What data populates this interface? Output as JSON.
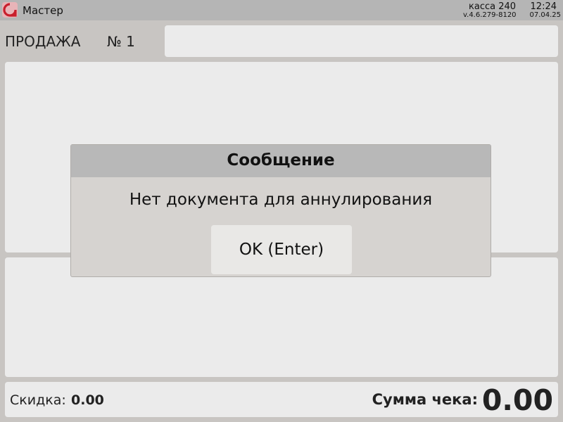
{
  "header": {
    "user": "Мастер",
    "cash_register": "касса 240",
    "time": "12:24",
    "version": "v.4.6.279-8120",
    "version_date": "07.04.25",
    "logo_icon": "brand-logo-icon",
    "logo_color": "#d02030"
  },
  "document": {
    "type": "ПРОДАЖА",
    "number": "№ 1"
  },
  "dialog": {
    "title": "Сообщение",
    "message": "Нет документа для аннулирования",
    "ok_label": "OK (Enter)"
  },
  "footer": {
    "discount_label": "Скидка:",
    "discount_value": "0.00",
    "total_label": "Сумма чека:",
    "total_value": "0.00"
  }
}
